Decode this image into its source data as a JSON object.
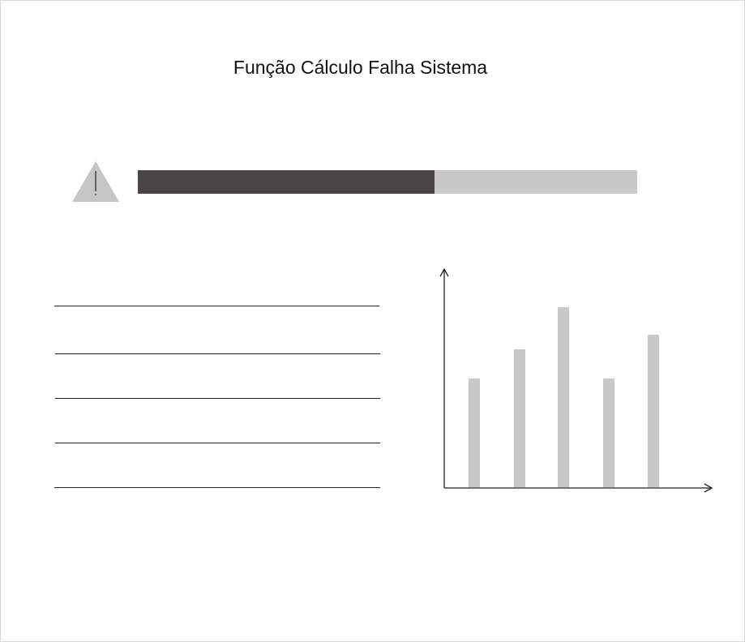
{
  "title": "Função Cálculo Falha Sistema",
  "warning_icon": "warning-triangle-icon",
  "progress": {
    "value": 0.594,
    "fill_color": "#4a4546",
    "track_color": "#c8c8c8"
  },
  "text_lines": 5,
  "chart_data": {
    "type": "bar",
    "categories": [
      "",
      "",
      "",
      "",
      ""
    ],
    "values": [
      134,
      170,
      222,
      134,
      188
    ],
    "title": "",
    "xlabel": "",
    "ylabel": "",
    "ylim": [
      0,
      268
    ],
    "grid": false,
    "bar_color": "#c8c8c8"
  }
}
